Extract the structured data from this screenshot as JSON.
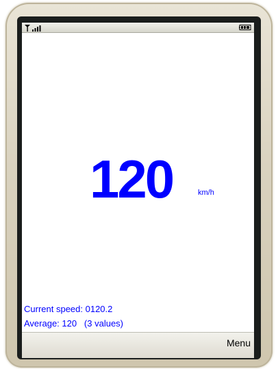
{
  "status_bar": {
    "signal_icon": "signal-strength-icon",
    "battery_icon": "battery-icon"
  },
  "speedometer": {
    "speed": "120",
    "unit": "km/h"
  },
  "info": {
    "current_speed": "Current speed: 0120.2",
    "average": "Average: 120   (3 values)"
  },
  "softkeys": {
    "menu_label": "Menu"
  },
  "colors": {
    "speed_text": "#0000ff",
    "bezel": "#1a1d1c",
    "phone_body": "#d9d2bf"
  }
}
